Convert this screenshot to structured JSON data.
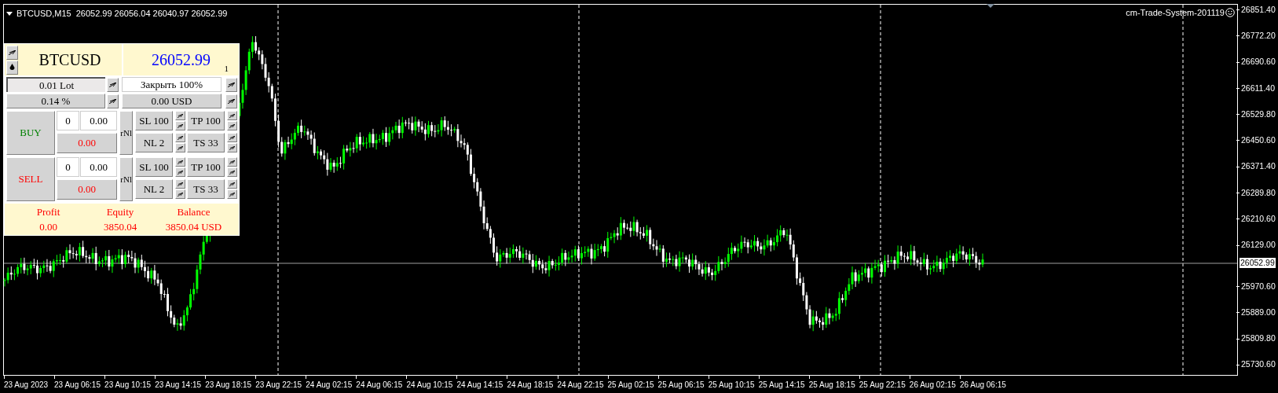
{
  "chart_header": {
    "symbol": "BTCUSD,M15",
    "ohlc": "26052.99 26056.04 26040.97 26052.99"
  },
  "indicator_label": "cm-Trade-System-201119",
  "price_axis": {
    "labels": [
      "26851.40",
      "26772.20",
      "26690.60",
      "26611.40",
      "26529.80",
      "26450.60",
      "26371.40",
      "26289.80",
      "26210.60",
      "26129.00",
      "25970.60",
      "25889.00",
      "25809.80",
      "25730.60"
    ],
    "current_price": "26052.99"
  },
  "time_axis": {
    "labels": [
      "23 Aug 2023",
      "23 Aug 06:15",
      "23 Aug 10:15",
      "23 Aug 14:15",
      "23 Aug 18:15",
      "23 Aug 22:15",
      "24 Aug 02:15",
      "24 Aug 06:15",
      "24 Aug 10:15",
      "24 Aug 14:15",
      "24 Aug 18:15",
      "24 Aug 22:15",
      "25 Aug 02:15",
      "25 Aug 06:15",
      "25 Aug 10:15",
      "25 Aug 14:15",
      "25 Aug 18:15",
      "25 Aug 22:15",
      "26 Aug 02:15",
      "26 Aug 06:15"
    ]
  },
  "panel": {
    "symbol": "BTCUSD",
    "price": "26052.99",
    "price_index": "1",
    "lot": "0.01 Lot",
    "close_label": "Закрыть 100%",
    "risk": "0.14 %",
    "amount": "0.00 USD",
    "orders": [
      {
        "kind": "buy",
        "label": "BUY",
        "count": "0",
        "volume": "0.00",
        "profit": "0.00",
        "toggle": "rNl",
        "sl": "SL 100",
        "tp": "TP 100",
        "nl": "NL 2",
        "ts": "TS 33"
      },
      {
        "kind": "sell",
        "label": "SELL",
        "count": "0",
        "volume": "0.00",
        "profit": "0.00",
        "toggle": "rNl",
        "sl": "SL 100",
        "tp": "TP 100",
        "nl": "NL 2",
        "ts": "TS 33"
      }
    ],
    "summary": [
      {
        "label": "Profit",
        "value": "0.00"
      },
      {
        "label": "Equity",
        "value": "3850.04"
      },
      {
        "label": "Balance",
        "value": "3850.04 USD"
      }
    ]
  }
}
